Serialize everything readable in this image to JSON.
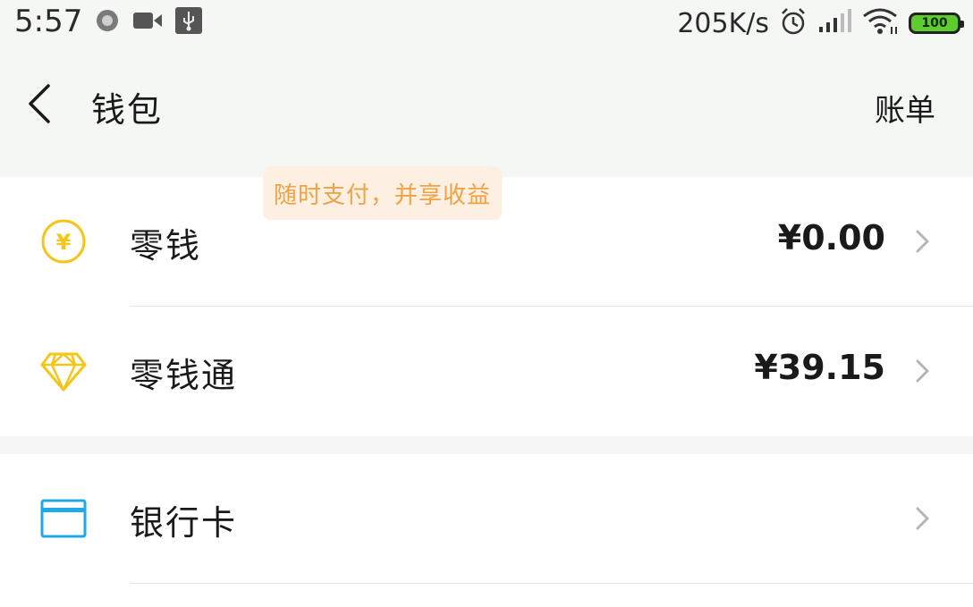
{
  "status_bar": {
    "time": "5:57",
    "network_speed": "205K/s",
    "battery_level": "100",
    "left_icons": [
      "record-dot-icon",
      "video-camera-icon",
      "usb-icon"
    ],
    "right_icons": [
      "alarm-clock-icon",
      "signal-icon",
      "wifi-icon",
      "battery-icon"
    ]
  },
  "header": {
    "title": "钱包",
    "bill_label": "账单"
  },
  "items": [
    {
      "icon": "yuan-coin-icon",
      "label": "零钱",
      "amount": "¥0.00"
    },
    {
      "icon": "diamond-icon",
      "label": "零钱通",
      "badge": "随时支付，并享收益",
      "amount": "¥39.15"
    },
    {
      "icon": "bank-card-icon",
      "label": "银行卡",
      "amount": ""
    }
  ],
  "colors": {
    "background": "#f4f7f4",
    "coin_yellow": "#f5c518",
    "card_blue": "#1fa9e6",
    "badge_text": "#f0a245",
    "badge_bg": "#fdf0e2"
  }
}
